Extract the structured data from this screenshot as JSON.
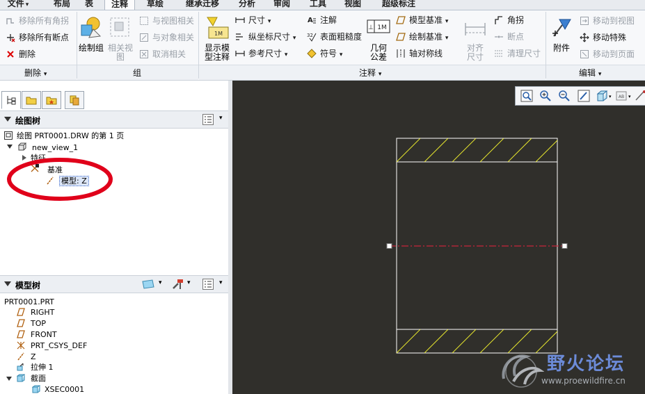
{
  "menu_tabs": [
    "文件",
    "布局",
    "表",
    "注释",
    "草绘",
    "继承迁移",
    "分析",
    "审阅",
    "工具",
    "视图",
    "超级标注"
  ],
  "file_arrow": "▾",
  "ribbon": {
    "delete_group": {
      "items": [
        "移除所有角拐",
        "移除所有断点",
        "删除"
      ],
      "label": "删除"
    },
    "group_group": {
      "big1": "绘制组",
      "big2": "相关视图",
      "items": [
        "与视图相关",
        "与对象相关",
        "取消相关"
      ],
      "label": "组"
    },
    "annotation_group": {
      "big1_line1": "显示模",
      "big1_line2": "型注释",
      "col1": [
        "尺寸",
        "纵坐标尺寸",
        "参考尺寸"
      ],
      "col2": [
        "注解",
        "表面粗糙度",
        "符号"
      ],
      "big2_line1": "几何",
      "big2_line2": "公差",
      "col3": [
        "模型基准",
        "绘制基准",
        "轴对称线"
      ],
      "big3_line1": "对齐",
      "big3_line2": "尺寸",
      "col4": [
        "角拐",
        "断点",
        "清理尺寸"
      ],
      "label": "注释"
    },
    "edit_group": {
      "big1": "附件",
      "items": [
        "移动到视图",
        "移动特殊",
        "移动到页面"
      ],
      "label": "编辑"
    }
  },
  "drawing_tree": {
    "title": "绘图树",
    "nodes": [
      "绘图 PRT0001.DRW 的第 1 页",
      "new_view_1",
      "特征",
      "基准",
      "模型: Z"
    ]
  },
  "model_tree": {
    "title": "模型树",
    "nodes": [
      "PRT0001.PRT",
      "RIGHT",
      "TOP",
      "FRONT",
      "PRT_CSYS_DEF",
      "Z",
      "拉伸 1",
      "截面",
      "XSEC0001"
    ]
  },
  "watermark": {
    "title": "野火论坛",
    "url": "www.proewildfire.cn"
  },
  "colors": {
    "canvas": "#302f2b",
    "drawing_line": "#ffffff",
    "hatch": "#e6e62e",
    "centerline": "#c8243a",
    "highlight_circle": "#e0001a",
    "selection": "#1f54c6"
  }
}
